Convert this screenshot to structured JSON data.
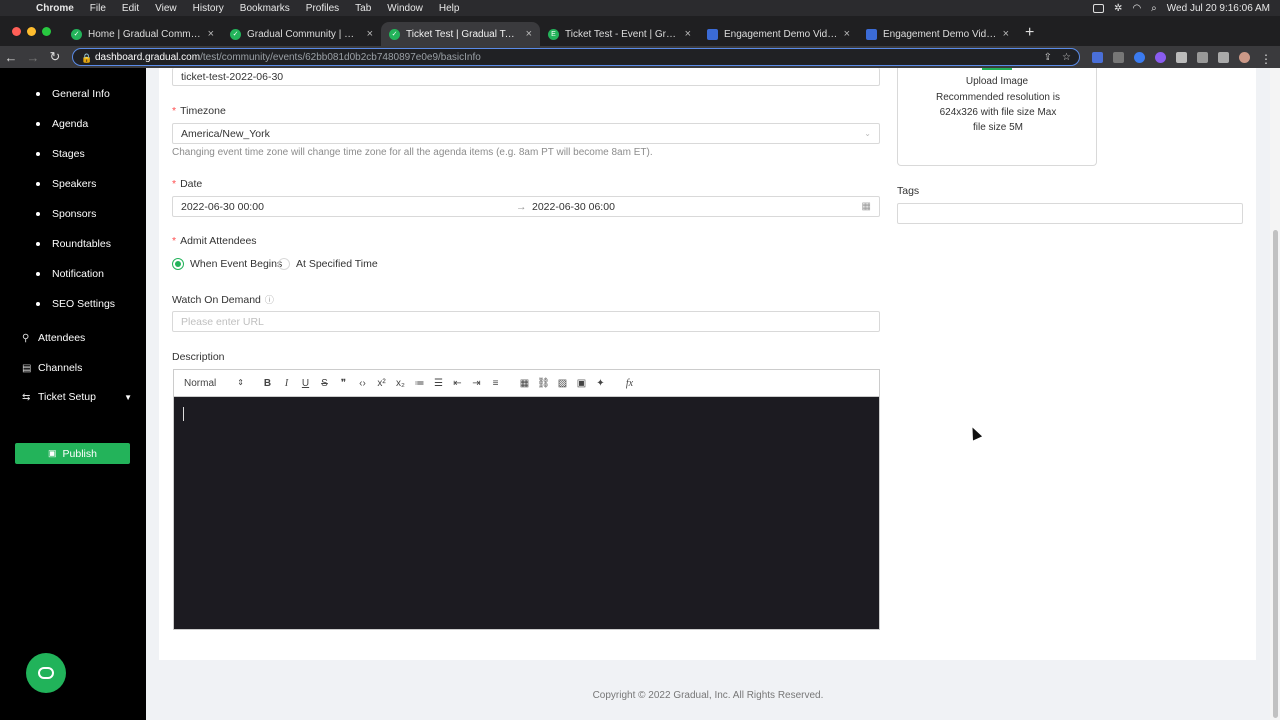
{
  "menubar": {
    "app": "Chrome",
    "items": [
      "File",
      "Edit",
      "View",
      "History",
      "Bookmarks",
      "Profiles",
      "Tab",
      "Window",
      "Help"
    ],
    "clock": "Wed Jul 20  9:16:06 AM"
  },
  "tabs": [
    {
      "title": "Home | Gradual Community",
      "favicon_color": "#23b35a",
      "active": false
    },
    {
      "title": "Gradual Community | Gradual Te",
      "favicon_color": "#23b35a",
      "active": false
    },
    {
      "title": "Ticket Test | Gradual Test | Gra",
      "favicon_color": "#23b35a",
      "active": true
    },
    {
      "title": "Ticket Test - Event | Gradual Te",
      "favicon_color": "#23b35a",
      "favicon_letter": "E",
      "active": false
    },
    {
      "title": "Engagement Demo Video - gra",
      "favicon_color": "#3b6bd6",
      "active": false
    },
    {
      "title": "Engagement Demo Video - gra",
      "favicon_color": "#3b6bd6",
      "active": false
    }
  ],
  "address": {
    "host": "dashboard.gradual.com",
    "path": "/test/community/events/62bb081d0b2cb7480897e0e9/basicInfo"
  },
  "sidebar": {
    "sub_items": [
      "General Info",
      "Agenda",
      "Stages",
      "Speakers",
      "Sponsors",
      "Roundtables",
      "Notification",
      "SEO Settings"
    ],
    "nav_items": [
      {
        "label": "Attendees",
        "icon": "user-icon"
      },
      {
        "label": "Channels",
        "icon": "channel-icon"
      },
      {
        "label": "Ticket Setup",
        "icon": "ticket-icon",
        "expandable": true
      }
    ],
    "publish_label": "Publish"
  },
  "form": {
    "slug_value": "ticket-test-2022-06-30",
    "timezone": {
      "label": "Timezone",
      "value": "America/New_York",
      "hint": "Changing event time zone will change time zone for all the agenda items (e.g. 8am PT will become 8am ET)."
    },
    "date": {
      "label": "Date",
      "start": "2022-06-30 00:00",
      "end": "2022-06-30 06:00"
    },
    "admit": {
      "label": "Admit Attendees",
      "options": [
        "When Event Begins",
        "At Specified Time"
      ],
      "selected": "When Event Begins"
    },
    "watch": {
      "label": "Watch On Demand",
      "placeholder": "Please enter URL"
    },
    "description": {
      "label": "Description",
      "format": "Normal"
    }
  },
  "upload": {
    "title": "Upload Image",
    "text": "Recommended resolution is 624x326 with file size Max file size 5M"
  },
  "tags": {
    "label": "Tags"
  },
  "footer": "Copyright © 2022 Gradual, Inc. All Rights Reserved.",
  "colors": {
    "accent": "#23b35a",
    "sidebar_bg": "#000000",
    "editor_bg": "#1c1b21"
  }
}
